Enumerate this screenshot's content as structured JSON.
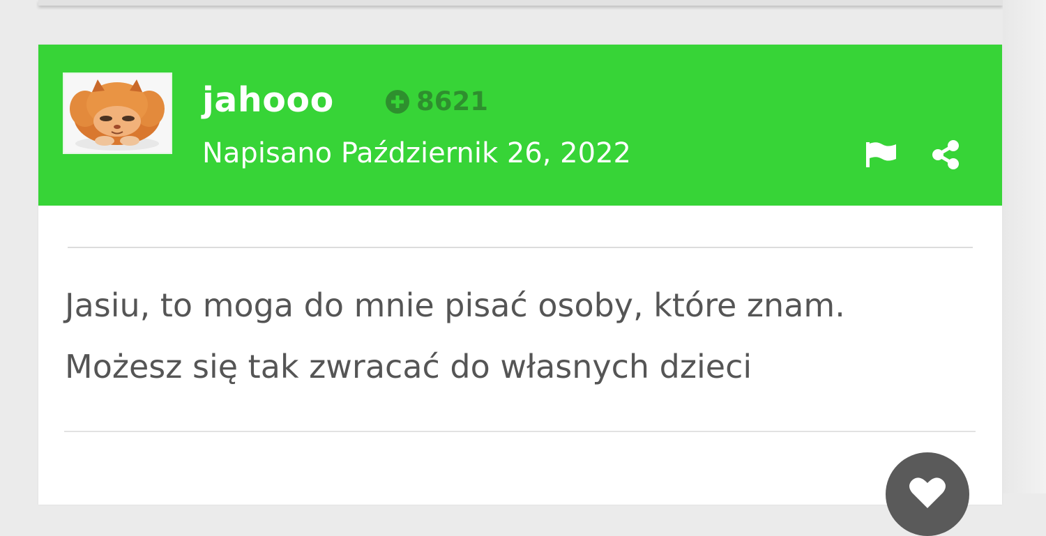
{
  "post": {
    "author": {
      "username": "jahooo",
      "avatar_icon": "persian-cat-avatar",
      "reputation": "8621",
      "reputation_icon": "plus-circle-icon"
    },
    "date_line": "Napisano Październik 26, 2022",
    "actions": {
      "report_icon": "flag-icon",
      "share_icon": "share-icon"
    },
    "body_lines": [
      "Jasiu, to moga do mnie pisać osoby, które znam.",
      "Możesz się tak zwracać do własnych dzieci"
    ],
    "reaction_icon": "heart-icon"
  },
  "colors": {
    "header_green": "#37d437",
    "reputation_green": "#2e8f2e",
    "body_text": "#555555",
    "page_background": "#ebebeb"
  }
}
